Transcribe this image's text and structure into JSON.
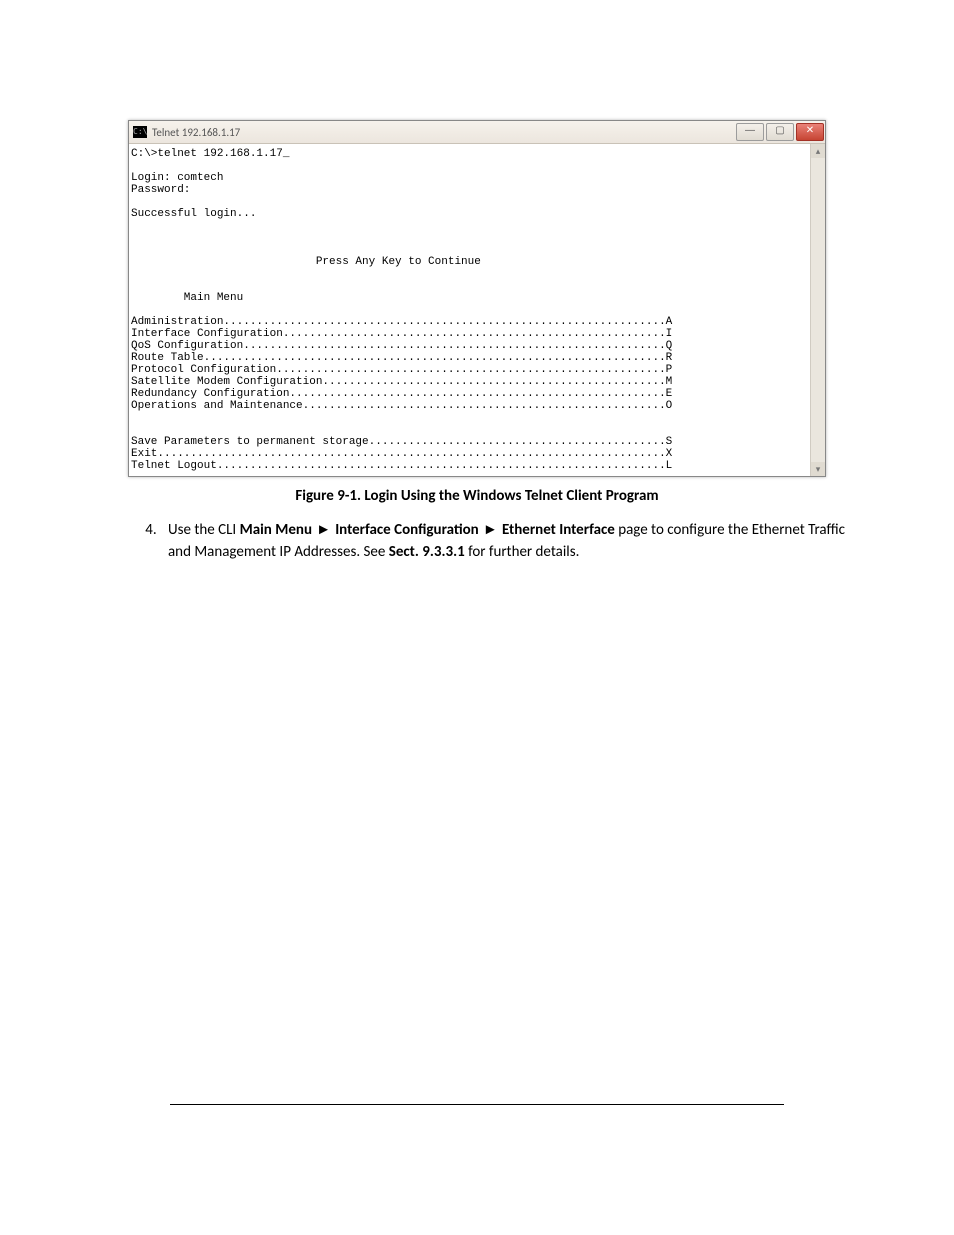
{
  "window": {
    "title": "Telnet 192.168.1.17",
    "icon_label": "C:\\"
  },
  "terminal": {
    "cmd": "C:\\>telnet 192.168.1.17_",
    "login_line": "Login: comtech",
    "password_line": "Password:",
    "success": "Successful login...",
    "continue_prompt": "Press Any Key to Continue",
    "menu_heading": "Main Menu",
    "menu_items": [
      {
        "label": "Administration",
        "key": "A"
      },
      {
        "label": "Interface Configuration",
        "key": "I"
      },
      {
        "label": "QoS Configuration",
        "key": "Q"
      },
      {
        "label": "Route Table",
        "key": "R"
      },
      {
        "label": "Protocol Configuration",
        "key": "P"
      },
      {
        "label": "Satellite Modem Configuration",
        "key": "M"
      },
      {
        "label": "Redundancy Configuration",
        "key": "E"
      },
      {
        "label": "Operations and Maintenance",
        "key": "O"
      }
    ],
    "menu_items2": [
      {
        "label": "Save Parameters to permanent storage",
        "key": "S"
      },
      {
        "label": "Exit",
        "key": "X"
      },
      {
        "label": "Telnet Logout",
        "key": "L"
      }
    ]
  },
  "caption": "Figure 9-1. Login Using the Windows Telnet Client Program",
  "step": {
    "number": "4.",
    "pre": "Use the CLI ",
    "b1": "Main Menu",
    "sep1": " ► ",
    "b2": "Interface Configuration",
    "sep2": " ► ",
    "b3": "Ethernet Interface",
    "mid": " page to configure the Ethernet Traffic and Management IP Addresses. See ",
    "b4": "Sect. 9.3.3.1",
    "post": " for further details."
  }
}
